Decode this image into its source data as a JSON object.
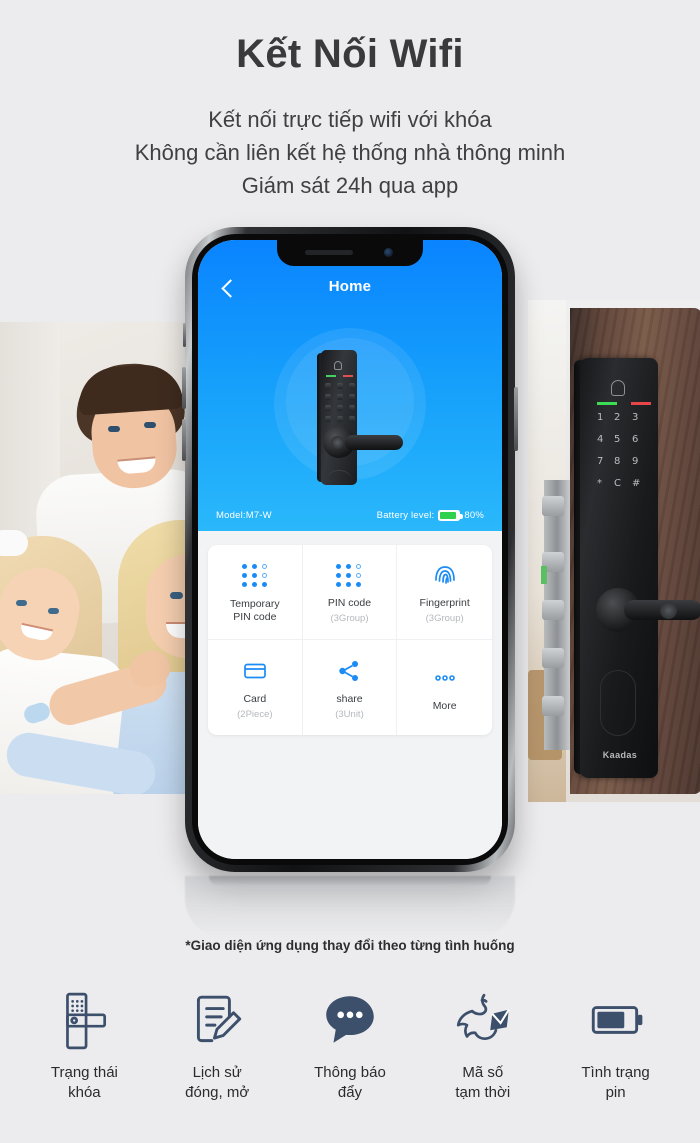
{
  "page": {
    "headline": "Kết Nối Wifi",
    "subtitles": [
      "Kết nối trực tiếp wifi với khóa",
      "Không cần liên kết hệ thống nhà thông minh",
      "Giám sát 24h qua app"
    ],
    "note": "*Giao diện ứng dụng thay đổi theo từng tình huống",
    "background_color": "#ececee",
    "heading_color": "#3a3a3c"
  },
  "phone_app": {
    "nav": {
      "back_icon": "chevron-left-icon",
      "title": "Home"
    },
    "hero": {
      "device_image": "smart-door-lock-illustration",
      "accent_color": "#0a84ff"
    },
    "status": {
      "model_label": "Model:M7-W",
      "battery_label": "Battery level:",
      "battery_percent": "80%",
      "battery_fill": 80,
      "battery_color": "#2fd04c"
    },
    "grid": [
      {
        "icon": "dot-matrix-icon",
        "label": "Temporary\nPIN code",
        "label_line1": "Temporary",
        "label_line2": "PIN code",
        "sub": ""
      },
      {
        "icon": "dot-matrix-icon",
        "label": "PIN code",
        "label_line1": "PIN code",
        "label_line2": "",
        "sub": "(3Group)"
      },
      {
        "icon": "fingerprint-icon",
        "label": "Fingerprint",
        "label_line1": "Fingerprint",
        "label_line2": "",
        "sub": "(3Group)"
      },
      {
        "icon": "card-icon",
        "label": "Card",
        "label_line1": "Card",
        "label_line2": "",
        "sub": "(2Piece)"
      },
      {
        "icon": "share-icon",
        "label": "share",
        "label_line1": "share",
        "label_line2": "",
        "sub": "(3Unit)"
      },
      {
        "icon": "more-dots-icon",
        "label": "More",
        "label_line1": "More",
        "label_line2": "",
        "sub": ""
      }
    ]
  },
  "door_lock_photo": {
    "brand": "Kaadas",
    "keypad": [
      "1",
      "2",
      "3",
      "4",
      "5",
      "6",
      "7",
      "8",
      "9",
      "*",
      "C",
      "#"
    ]
  },
  "features": [
    {
      "icon": "door-lock-status-icon",
      "line1": "Trạng thái",
      "line2": "khóa"
    },
    {
      "icon": "history-log-icon",
      "line1": "Lịch sử",
      "line2": "đóng, mở"
    },
    {
      "icon": "chat-bubble-icon",
      "line1": "Thông báo",
      "line2": "đẩy"
    },
    {
      "icon": "dove-mail-icon",
      "line1": "Mã số",
      "line2": "tạm thời"
    },
    {
      "icon": "battery-icon",
      "line1": "Tình trạng",
      "line2": "pin"
    }
  ]
}
